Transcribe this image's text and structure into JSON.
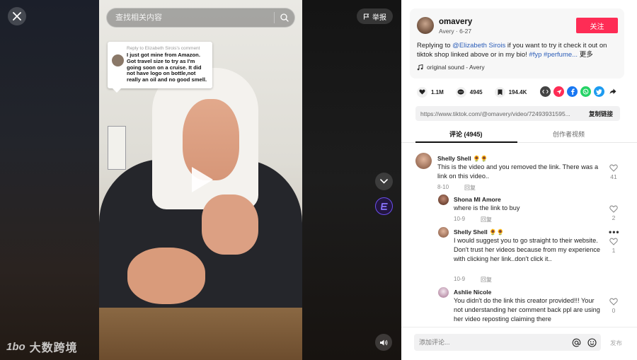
{
  "search": {
    "placeholder": "查找相关内容"
  },
  "report": {
    "label": "举报"
  },
  "reply_card": {
    "header": "Reply to Elizabeth Sirois's comment",
    "text": "I just got mine from Amazon. Got travel size to try as I'm going soon on a cruise. It did not have logo on bottle,not really an oil and no good smell."
  },
  "watermark": {
    "logo": "1bo",
    "text": "大数跨境"
  },
  "post": {
    "author": "omavery",
    "meta": "Avery · 6-27",
    "follow_label": "关注",
    "desc_prefix": "Replying to ",
    "mention": "@Elizabeth Sirois",
    "desc_body": " if you want to try it check it out on tiktok shop linked above or in my bio! ",
    "tags": "#fyp #perfume...",
    "more_label": "更多",
    "sound": "original sound - Avery"
  },
  "stats": {
    "likes": "1.1M",
    "comments": "4945",
    "saves": "194.4K"
  },
  "share_icons": [
    "embed-icon",
    "send-icon",
    "facebook-icon",
    "whatsapp-icon",
    "twitter-icon",
    "share-arrow-icon"
  ],
  "link": {
    "url": "https://www.tiktok.com/@omavery/video/72493931595...",
    "copy_label": "复制链接"
  },
  "tabs": {
    "comments": "评论 (4945)",
    "creator_videos": "创作者视频"
  },
  "comments": [
    {
      "name": "Shelly Shell 🌻🌻",
      "text": "This is the video and you removed the link. There was a link on this video..",
      "date": "8-10",
      "reply": "回复",
      "likes": "41"
    },
    {
      "name": "Shona MI Amore",
      "text": "where is the link to buy",
      "date": "10-9",
      "reply": "回复",
      "likes": "2"
    },
    {
      "name": "Shelly Shell 🌻🌻",
      "text": "I would suggest you to go straight to their website. Don't trust her videos because from my experience with clicking her link..don't click it..",
      "date": "10-9",
      "reply": "回复",
      "likes": "1",
      "more": "•••"
    },
    {
      "name": "Ashlie Nicole",
      "text": "You didn't do the link this creator provided!!! Your not understanding her comment back ppl are using her video reposting claiming there",
      "likes": "0"
    }
  ],
  "comment_input": {
    "placeholder": "添加评论...",
    "post_label": "发布"
  }
}
